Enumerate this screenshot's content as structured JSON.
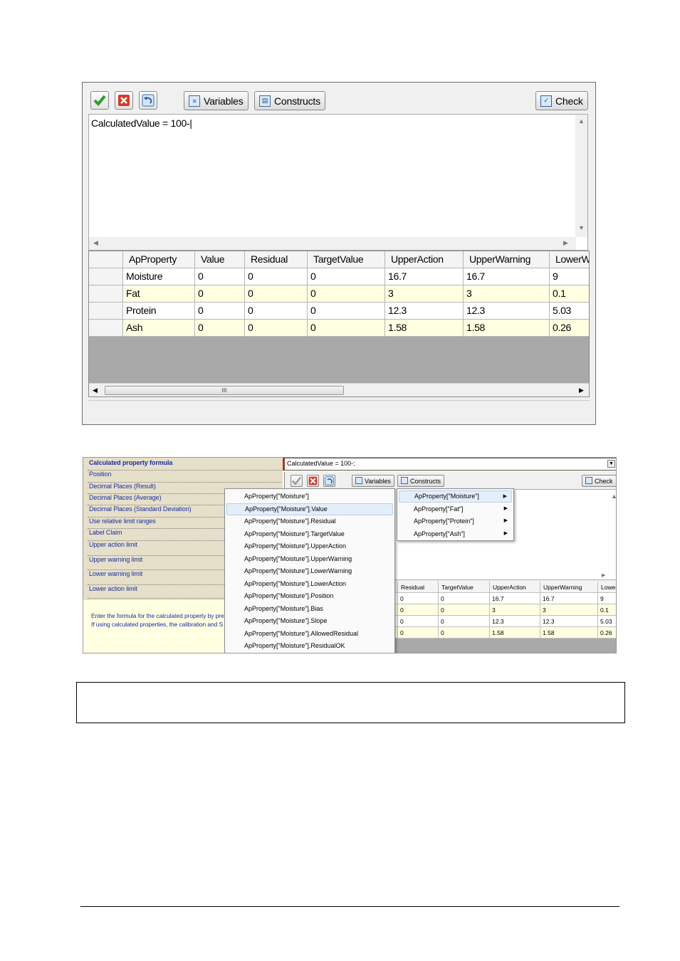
{
  "top_window": {
    "toolbar": {
      "accept_icon": "checkmark-icon",
      "cancel_icon": "red-x-icon",
      "undo_icon": "undo-arrow-icon",
      "variables_label": "Variables",
      "constructs_label": "Constructs",
      "check_label": "Check"
    },
    "editor_text": "CalculatedValue = 100-|",
    "grid": {
      "columns": [
        "ApProperty",
        "Value",
        "Residual",
        "TargetValue",
        "UpperAction",
        "UpperWarning",
        "LowerW"
      ],
      "rows": [
        [
          "Moisture",
          "0",
          "0",
          "0",
          "16.7",
          "16.7",
          "9"
        ],
        [
          "Fat",
          "0",
          "0",
          "0",
          "3",
          "3",
          "0.1"
        ],
        [
          "Protein",
          "0",
          "0",
          "0",
          "12.3",
          "12.3",
          "5.03"
        ],
        [
          "Ash",
          "0",
          "0",
          "0",
          "1.58",
          "1.58",
          "0.26"
        ]
      ],
      "scroll_thumb_label": "III"
    }
  },
  "bottom_window": {
    "properties": [
      "Calculated property formula",
      "Position",
      "Decimal Places (Result)",
      "Decimal Places (Average)",
      "Decimal Places (Standard Deviation)",
      "Use relative limit ranges",
      "Label Claim",
      "Upper action limit",
      "Upper warning limit",
      "Lower warning limit",
      "Lower action limit"
    ],
    "formula_value": "CalculatedValue = 100-;",
    "description": [
      "Enter the formula for the calculated property by pre",
      "If using calculated properties, the calibration and S"
    ],
    "toolbar": {
      "variables_label": "Variables",
      "constructs_label": "Constructs",
      "check_label": "Check"
    },
    "grid": {
      "columns": [
        "Residual",
        "TargetValue",
        "UpperAction",
        "UpperWarning",
        "LowerW"
      ],
      "rows": [
        [
          "0",
          "0",
          "16.7",
          "16.7",
          "9"
        ],
        [
          "0",
          "0",
          "3",
          "3",
          "0.1"
        ],
        [
          "0",
          "0",
          "12.3",
          "12.3",
          "5.03"
        ],
        [
          "0",
          "0",
          "1.58",
          "1.58",
          "0.26"
        ]
      ]
    },
    "menu_members": [
      "ApProperty[\"Moisture\"]",
      "ApProperty[\"Moisture\"].Value",
      "ApProperty[\"Moisture\"].Residual",
      "ApProperty[\"Moisture\"].TargetValue",
      "ApProperty[\"Moisture\"].UpperAction",
      "ApProperty[\"Moisture\"].UpperWarning",
      "ApProperty[\"Moisture\"].LowerWarning",
      "ApProperty[\"Moisture\"].LowerAction",
      "ApProperty[\"Moisture\"].Position",
      "ApProperty[\"Moisture\"].Bias",
      "ApProperty[\"Moisture\"].Slope",
      "ApProperty[\"Moisture\"].AllowedResidual",
      "ApProperty[\"Moisture\"].ResidualOK"
    ],
    "menu_properties": [
      "ApProperty[\"Moisture\"]",
      "ApProperty[\"Fat\"]",
      "ApProperty[\"Protein\"]",
      "ApProperty[\"Ash\"]"
    ]
  },
  "colors": {
    "row_alt": "#ffffe1",
    "grid_empty": "#a9a9a9",
    "property_text": "#1a2fa0"
  }
}
